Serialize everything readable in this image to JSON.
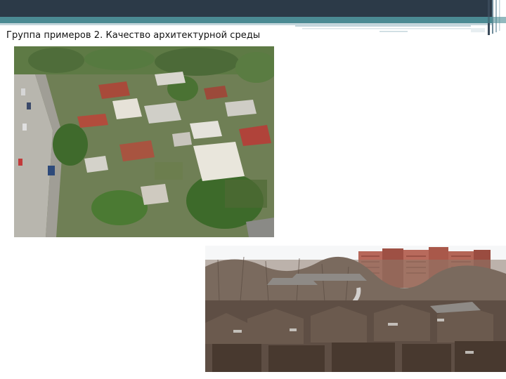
{
  "slide": {
    "title": "Группа примеров 2. Качество архитектурной среды"
  },
  "theme": {
    "header_dark": "#2c3a48",
    "header_teal": "#4b8a93",
    "header_light": "#c4d6dc",
    "title_color": "#111111"
  },
  "photos": [
    {
      "name": "aerial-view-private-housing"
    },
    {
      "name": "old-wooden-houses-with-highrise-background"
    }
  ]
}
